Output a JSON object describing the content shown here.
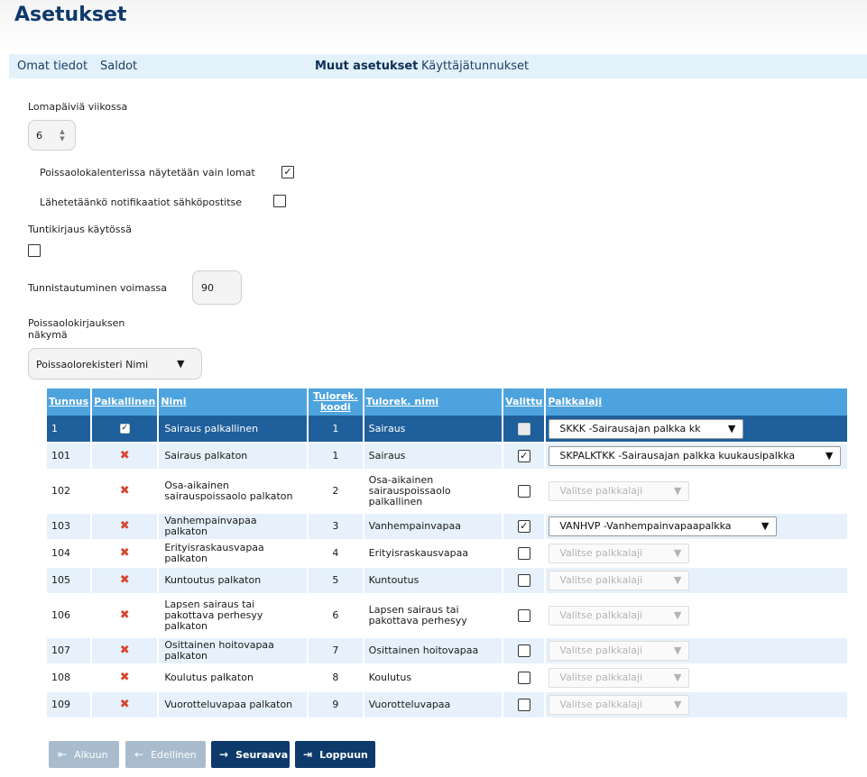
{
  "page": {
    "title": "Asetukset"
  },
  "nav": [
    "Omat tiedot",
    "Saldot",
    "Muut asetukset",
    "Käyttäjätunnukset"
  ],
  "settings": {
    "vacation_days_label": "Lomapäiviä viikossa",
    "vacation_days_value": "6",
    "only_vacations_label": "Poissaolokalenterissa näytetään vain lomat",
    "only_vacations_checked": true,
    "notify_email_label": "Lähetetäänkö notifikaatiot sähköpostitse",
    "notify_email_checked": false,
    "hour_logging_label": "Tuntikirjaus käytössä",
    "hour_logging_checked": false,
    "auth_valid_label": "Tunnistautuminen voimassa",
    "auth_valid_value": "90",
    "absence_view_label_1": "Poissaolokirjauksen",
    "absence_view_label_2": "näkymä",
    "absence_view_value": "Poissaolorekisteri Nimi"
  },
  "table": {
    "headers": {
      "tunnus": "Tunnus",
      "palkallinen": "Palkallinen",
      "nimi": "Nimi",
      "tulorek_koodi_1": "Tulorek.",
      "tulorek_koodi_2": "koodi",
      "tulorek_nimi": "Tulorek. nimi",
      "valittu": "Valittu",
      "palkkalaji": "Palkkalaji"
    },
    "placeholder": "Valitse palkkalaji",
    "rows": [
      {
        "id": "1",
        "paid": true,
        "name": "Sairaus palkallinen",
        "code": "1",
        "code_name": "Sairaus",
        "selected": false,
        "pay_type": "SKKK -Sairausajan palkka kk"
      },
      {
        "id": "101",
        "paid": false,
        "name": "Sairaus palkaton",
        "code": "1",
        "code_name": "Sairaus",
        "selected": true,
        "pay_type": "SKPALKTKK -Sairausajan palkka kuukausipalkka"
      },
      {
        "id": "102",
        "paid": false,
        "name": "Osa-aikainen sairauspoissaolo palkaton",
        "code": "2",
        "code_name": "Osa-aikainen sairauspoissaolo palkallinen",
        "selected": false,
        "pay_type": ""
      },
      {
        "id": "103",
        "paid": false,
        "name": "Vanhempainvapaa palkaton",
        "code": "3",
        "code_name": "Vanhempainvapaa",
        "selected": true,
        "pay_type": "VANHVP -Vanhempainvapaapalkka"
      },
      {
        "id": "104",
        "paid": false,
        "name": "Erityisraskausvapaa palkaton",
        "code": "4",
        "code_name": "Erityisraskausvapaa",
        "selected": false,
        "pay_type": ""
      },
      {
        "id": "105",
        "paid": false,
        "name": "Kuntoutus palkaton",
        "code": "5",
        "code_name": "Kuntoutus",
        "selected": false,
        "pay_type": ""
      },
      {
        "id": "106",
        "paid": false,
        "name": "Lapsen sairaus tai pakottava perhesyy palkaton",
        "code": "6",
        "code_name": "Lapsen sairaus tai pakottava perhesyy",
        "selected": false,
        "pay_type": ""
      },
      {
        "id": "107",
        "paid": false,
        "name": "Osittainen hoitovapaa palkaton",
        "code": "7",
        "code_name": "Osittainen hoitovapaa",
        "selected": false,
        "pay_type": ""
      },
      {
        "id": "108",
        "paid": false,
        "name": "Koulutus palkaton",
        "code": "8",
        "code_name": "Koulutus",
        "selected": false,
        "pay_type": ""
      },
      {
        "id": "109",
        "paid": false,
        "name": "Vuorotteluvapaa palkaton",
        "code": "9",
        "code_name": "Vuorotteluvapaa",
        "selected": false,
        "pay_type": ""
      }
    ]
  },
  "pagination": {
    "first": "Alkuun",
    "prev": "Edellinen",
    "next": "Seuraava",
    "last": "Loppuun"
  },
  "colors": {
    "brand": "#0e3a6b",
    "header": "#4da3dd",
    "selected_row": "#1f5f9b",
    "unpaid_mark": "#d9452f"
  },
  "icons": {
    "paid": "check-icon",
    "unpaid": "cross-icon",
    "dropdown": "caret-down-icon"
  }
}
